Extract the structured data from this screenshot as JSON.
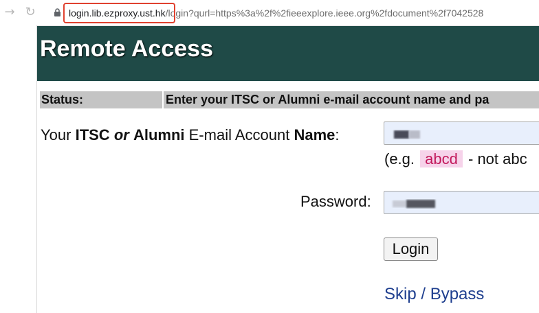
{
  "browser": {
    "url_host": "login.lib.ezproxy.ust.hk",
    "url_path": "/login?qurl=https%3a%2f%2fieeexplore.ieee.org%2fdocument%2f7042528",
    "back_icon": "arrow-right-icon",
    "reload_icon": "reload-icon"
  },
  "page": {
    "title": "Remote Access",
    "status_label": "Status:",
    "status_message": "Enter your ITSC or Alumni e-mail account name and pa",
    "name_label": {
      "part1": "Your ",
      "itsc": "ITSC",
      "or": "or",
      "alumni": "Alumni",
      "part2": " E-mail Account ",
      "name": "Name",
      "colon": ":"
    },
    "example": {
      "prefix": "(e.g.",
      "code": "abcd",
      "suffix": "- not abc"
    },
    "password_label": "Password:",
    "login_button": "Login",
    "skip_link": "Skip / Bypass"
  },
  "colors": {
    "banner": "#1f4a47",
    "status_bg": "#c4c4c4",
    "input_bg": "#e8effc",
    "link": "#1f3f8f",
    "highlight": "#e0412f"
  }
}
